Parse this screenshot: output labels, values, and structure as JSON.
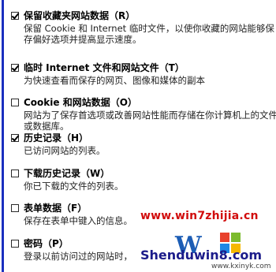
{
  "items": [
    {
      "title": "保留收藏夹网站数据（R）",
      "desc": "保留 Cookie 和 Internet 临时文件，以使你收藏的网站能够保存偏好选项并提高显示速度。",
      "checked": true
    },
    {
      "title": "临时 Internet 文件和网站文件（T）",
      "desc": "为快速查看而保存的网页、图像和媒体的副本",
      "checked": true
    },
    {
      "title": "Cookie 和网站数据（O）",
      "desc": "网站为了保存首选项或改善网站性能而存储在你计算机上的文件或数据库。",
      "checked": false
    },
    {
      "title": "历史记录（H）",
      "desc": "已访问网站的列表。",
      "checked": true
    },
    {
      "title": "下载历史记录（W）",
      "desc": "你已下载的文件的列表。",
      "checked": false
    },
    {
      "title": "表单数据（F）",
      "desc": "保存在表单中键入的信息。",
      "checked": false
    },
    {
      "title": "密码（P）",
      "desc": "登录以前访问过的网站时，",
      "checked": false
    }
  ],
  "watermark": {
    "url": "www.win7zhijia.cn",
    "brand": "Shenduwin8.com",
    "site": "www.kxinyk.com"
  }
}
